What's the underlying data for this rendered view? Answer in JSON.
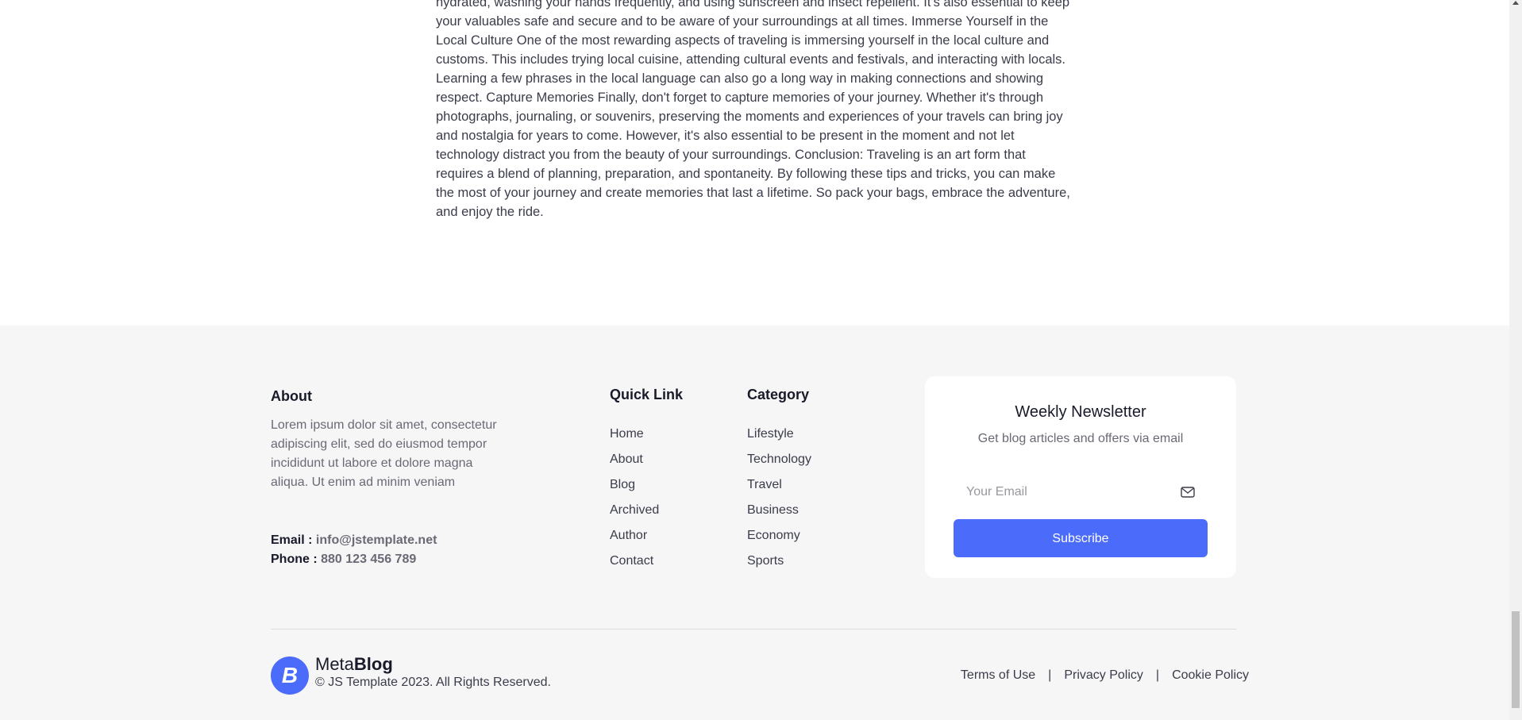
{
  "article": {
    "text": "hydrated, washing your hands frequently, and using sunscreen and insect repellent. It's also essential to keep your valuables safe and secure and to be aware of your surroundings at all times. Immerse Yourself in the Local Culture One of the most rewarding aspects of traveling is immersing yourself in the local culture and customs. This includes trying local cuisine, attending cultural events and festivals, and interacting with locals. Learning a few phrases in the local language can also go a long way in making connections and showing respect. Capture Memories Finally, don't forget to capture memories of your journey. Whether it's through photographs, journaling, or souvenirs, preserving the moments and experiences of your travels can bring joy and nostalgia for years to come. However, it's also essential to be present in the moment and not let technology distract you from the beauty of your surroundings. Conclusion: Traveling is an art form that requires a blend of planning, preparation, and spontaneity. By following these tips and tricks, you can make the most of your journey and create memories that last a lifetime. So pack your bags, embrace the adventure, and enjoy the ride."
  },
  "footer": {
    "about": {
      "title": "About",
      "text": "Lorem ipsum dolor sit amet, consectetur adipiscing elit, sed do eiusmod tempor incididunt ut labore et dolore magna aliqua. Ut enim ad minim veniam",
      "email_label": "Email :",
      "email": "info@jstemplate.net",
      "phone_label": "Phone :",
      "phone": "880 123 456 789"
    },
    "quick_link": {
      "title": "Quick Link",
      "items": [
        "Home",
        "About",
        "Blog",
        "Archived",
        "Author",
        "Contact"
      ]
    },
    "category": {
      "title": "Category",
      "items": [
        "Lifestyle",
        "Technology",
        "Travel",
        "Business",
        "Economy",
        "Sports"
      ]
    },
    "newsletter": {
      "title": "Weekly Newsletter",
      "subtitle": "Get blog articles and offers via email",
      "placeholder": "Your Email",
      "button": "Subscribe",
      "icon": "mail-icon"
    },
    "bottom": {
      "brand_light": "Meta",
      "brand_bold": "Blog",
      "logo_letter": "B",
      "copyright": "© JS Template 2023. All Rights Reserved.",
      "legal": [
        "Terms of Use",
        "Privacy Policy",
        "Cookie Policy"
      ],
      "separator": "|"
    }
  },
  "colors": {
    "accent": "#4b6bfb",
    "footer_bg": "#f6f6f7",
    "heading": "#181a2a",
    "muted": "#696a75"
  }
}
